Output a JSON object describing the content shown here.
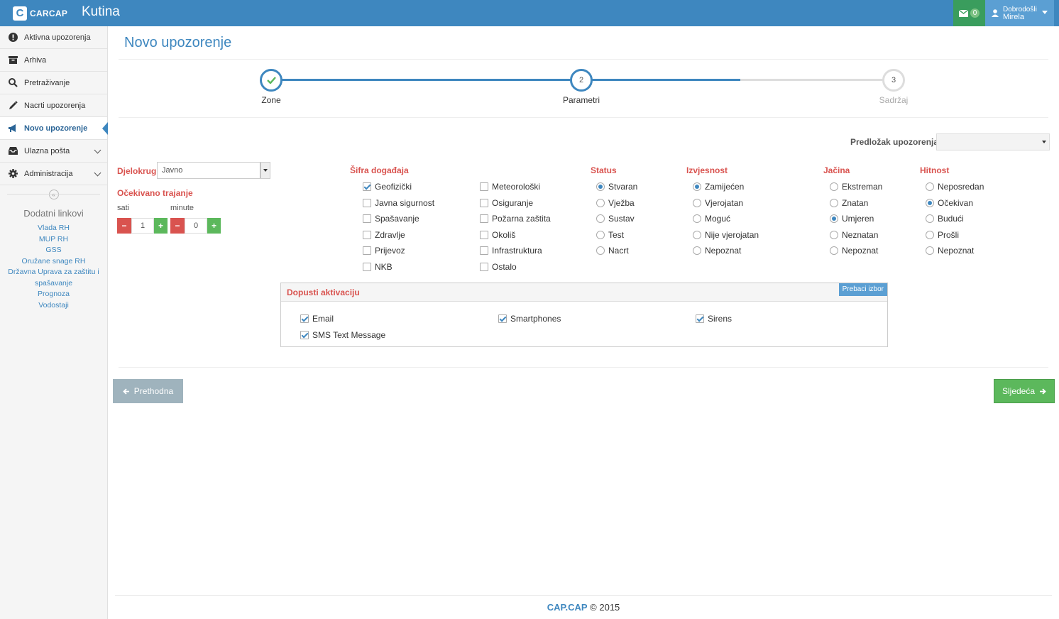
{
  "app": {
    "brand": "CARCAP",
    "city": "Kutina",
    "logo_letter": "C"
  },
  "header": {
    "mail_count": "0",
    "greeting": "Dobrodošli",
    "user_name": "Mirela"
  },
  "sidebar": {
    "items": [
      {
        "label": "Aktivna upozorenja",
        "icon": "exclamation-circle-icon"
      },
      {
        "label": "Arhiva",
        "icon": "archive-icon"
      },
      {
        "label": "Pretraživanje",
        "icon": "search-icon"
      },
      {
        "label": "Nacrti upozorenja",
        "icon": "pencil-icon"
      },
      {
        "label": "Novo upozorenje",
        "icon": "megaphone-icon",
        "active": true
      },
      {
        "label": "Ulazna pošta",
        "icon": "inbox-icon"
      },
      {
        "label": "Administracija",
        "icon": "gear-icon"
      }
    ],
    "collapse_glyph": "«",
    "links_title": "Dodatni linkovi",
    "links": [
      "Vlada RH",
      "MUP RH",
      "GSS",
      "Oružane snage RH",
      "Državna Uprava za zaštitu i spašavanje",
      "Prognoza",
      "Vodostaji"
    ]
  },
  "page": {
    "title": "Novo upozorenje"
  },
  "wizard": {
    "steps": [
      {
        "label": "Zone",
        "number": "",
        "state": "done"
      },
      {
        "label": "Parametri",
        "number": "2",
        "state": "current"
      },
      {
        "label": "Sadržaj",
        "number": "3",
        "state": "pending"
      }
    ]
  },
  "form": {
    "template_label": "Predložak upozorenja",
    "template_value": "",
    "scope_label": "Djelokrug",
    "scope_value": "Javno",
    "duration_label": "Očekivano trajanje",
    "hours_label": "sati",
    "minutes_label": "minute",
    "hours_value": "1",
    "minutes_value": "0",
    "minus": "−",
    "plus": "+",
    "event_code_label": "Šifra događaja",
    "event_codes_col1": [
      {
        "label": "Geofizički",
        "checked": true
      },
      {
        "label": "Javna sigurnost",
        "checked": false
      },
      {
        "label": "Spašavanje",
        "checked": false
      },
      {
        "label": "Zdravlje",
        "checked": false
      },
      {
        "label": "Prijevoz",
        "checked": false
      },
      {
        "label": "NKB",
        "checked": false
      }
    ],
    "event_codes_col2": [
      {
        "label": "Meteorološki",
        "checked": false
      },
      {
        "label": "Osiguranje",
        "checked": false
      },
      {
        "label": "Požarna zaštita",
        "checked": false
      },
      {
        "label": "Okoliš",
        "checked": false
      },
      {
        "label": "Infrastruktura",
        "checked": false
      },
      {
        "label": "Ostalo",
        "checked": false
      }
    ],
    "status_label": "Status",
    "status": [
      {
        "label": "Stvaran",
        "checked": true
      },
      {
        "label": "Vježba",
        "checked": false
      },
      {
        "label": "Sustav",
        "checked": false
      },
      {
        "label": "Test",
        "checked": false
      },
      {
        "label": "Nacrt",
        "checked": false
      }
    ],
    "certainty_label": "Izvjesnost",
    "certainty": [
      {
        "label": "Zamijećen",
        "checked": true
      },
      {
        "label": "Vjerojatan",
        "checked": false
      },
      {
        "label": "Moguć",
        "checked": false
      },
      {
        "label": "Nije vjerojatan",
        "checked": false
      },
      {
        "label": "Nepoznat",
        "checked": false
      }
    ],
    "severity_label": "Jačina",
    "severity": [
      {
        "label": "Ekstreman",
        "checked": false
      },
      {
        "label": "Znatan",
        "checked": false
      },
      {
        "label": "Umjeren",
        "checked": true
      },
      {
        "label": "Neznatan",
        "checked": false
      },
      {
        "label": "Nepoznat",
        "checked": false
      }
    ],
    "urgency_label": "Hitnost",
    "urgency": [
      {
        "label": "Neposredan",
        "checked": false
      },
      {
        "label": "Očekivan",
        "checked": true
      },
      {
        "label": "Budući",
        "checked": false
      },
      {
        "label": "Prošli",
        "checked": false
      },
      {
        "label": "Nepoznat",
        "checked": false
      }
    ],
    "activation": {
      "title": "Dopusti aktivaciju",
      "toggle_button": "Prebaci izbor",
      "channels": [
        {
          "label": "Email",
          "checked": true
        },
        {
          "label": "Smartphones",
          "checked": true
        },
        {
          "label": "Sirens",
          "checked": true
        },
        {
          "label": "SMS Text Message",
          "checked": true
        }
      ]
    }
  },
  "nav": {
    "prev": "Prethodna",
    "next": "Sljedeća",
    "prev_icon": "arrow-left-icon",
    "next_icon": "arrow-right-icon"
  },
  "footer": {
    "brand": "CAP.CAP",
    "copyright": "© 2015"
  },
  "colors": {
    "primary": "#3e87bf",
    "danger": "#d9534f",
    "success": "#5cb85c"
  }
}
